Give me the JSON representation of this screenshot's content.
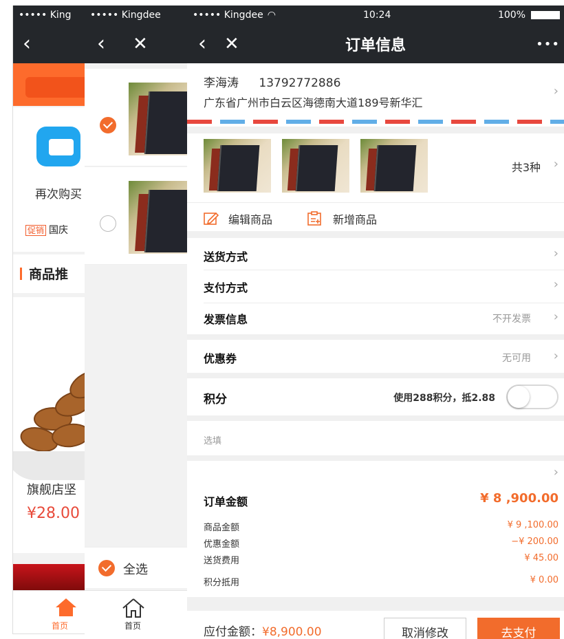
{
  "screen1": {
    "carrier": "••••• King",
    "back_icon": "chevron-left-icon",
    "rebuy_label": "再次购买",
    "promo_tag": "促销",
    "promo_text": "国庆",
    "recommend_title": "商品推",
    "product_name": "旗舰店坚",
    "product_price": "¥28.00",
    "tab_home": "首页",
    "accent": "#fd6b2c"
  },
  "screen2": {
    "carrier": "••••• Kingdee",
    "select_all": "全选",
    "tab_home": "首页"
  },
  "screen3": {
    "carrier": "••••• Kingdee",
    "time": "10:24",
    "battery": "100%",
    "title": "订单信息",
    "more_icon": "•••",
    "address": {
      "name": "李海涛",
      "phone": "13792772886",
      "line": "广东省广州市白云区海德南大道189号新华汇"
    },
    "goods_count": "共3种",
    "edit_goods": "编辑商品",
    "add_goods": "新增商品",
    "rows": {
      "delivery": "送货方式",
      "payment": "支付方式",
      "invoice": "发票信息",
      "invoice_value": "不开发票",
      "coupon": "优惠券",
      "coupon_value": "无可用",
      "points": "积分",
      "points_value": "使用288积分，抵2.88",
      "points_toggle_on": false,
      "note_placeholder": "选填"
    },
    "summary": {
      "order_total_label": "订单金额",
      "order_total": "¥ 8 ,900.00",
      "items": [
        {
          "label": "商品金额",
          "value": "¥ 9 ,100.00"
        },
        {
          "label": "优惠金额",
          "value": "−¥ 200.00"
        },
        {
          "label": "送货费用",
          "value": "¥ 45.00"
        },
        {
          "label": "积分抵用",
          "value": "¥ 0.00"
        }
      ]
    },
    "footer": {
      "payable_label": "应付金额：",
      "payable_value": "¥8,900.00",
      "cancel": "取消修改",
      "pay": "去支付"
    },
    "accent": "#f26c2c",
    "dark_bar": "#24272b"
  }
}
